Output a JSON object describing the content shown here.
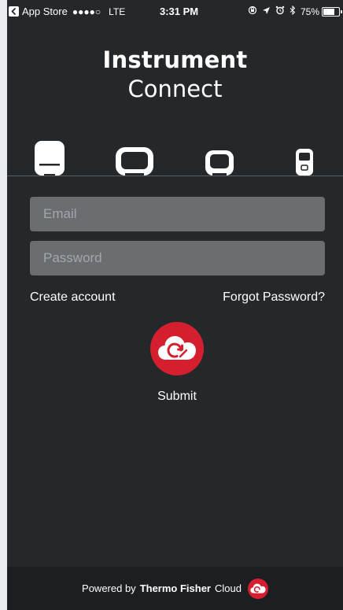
{
  "status_bar": {
    "back_app": "App Store",
    "signal": "●●●●○",
    "carrier": "LTE",
    "time": "3:31 PM",
    "battery_percent": "75%",
    "battery_level": 0.75,
    "icons": [
      "back-arrow-icon",
      "screen-rotation-lock-icon",
      "location-arrow-icon",
      "alarm-clock-icon",
      "bluetooth-icon",
      "battery-icon"
    ]
  },
  "header": {
    "title_line1": "Instrument",
    "title_line2": "Connect"
  },
  "instruments": [
    "large-instrument-icon",
    "wide-instrument-icon",
    "compact-instrument-icon",
    "handheld-instrument-icon"
  ],
  "form": {
    "email_placeholder": "Email",
    "email_value": "",
    "password_placeholder": "Password",
    "password_value": "",
    "create_account_label": "Create account",
    "forgot_password_label": "Forgot Password?",
    "submit_label": "Submit",
    "submit_icon": "cloud-sync-icon"
  },
  "footer": {
    "powered_by": "Powered by",
    "brand": "Thermo Fisher",
    "cloud": "Cloud",
    "logo_icon": "cloud-logo-icon"
  },
  "colors": {
    "background": "#25282a",
    "input_background": "#6a6e71",
    "accent_red": "#d51f2f",
    "footer_background": "#1c1f21"
  }
}
